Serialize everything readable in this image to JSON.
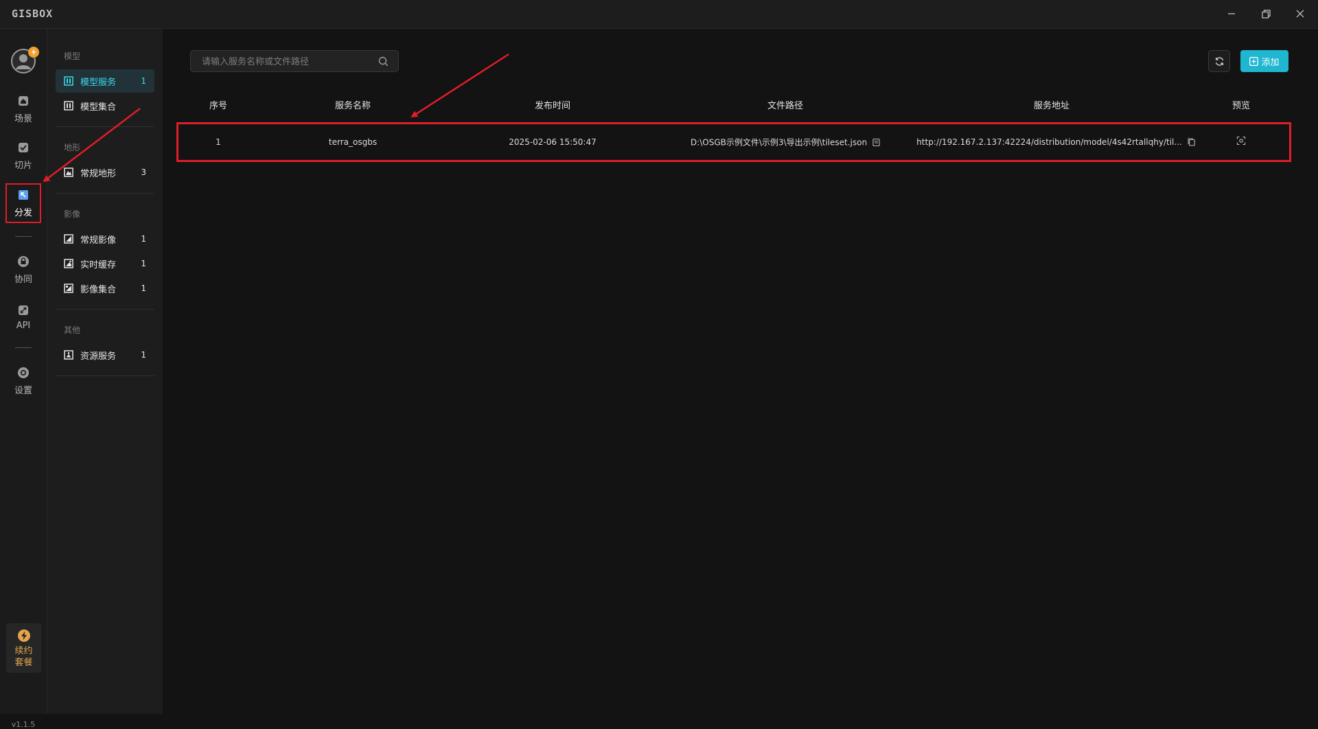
{
  "app": {
    "logo": "GISBOX"
  },
  "rail": {
    "items": [
      {
        "label": "场景"
      },
      {
        "label": "切片"
      },
      {
        "label": "分发"
      },
      {
        "label": "协同"
      },
      {
        "label": "API"
      },
      {
        "label": "设置"
      }
    ],
    "renew_label": "续约套餐",
    "version": "v1.1.5"
  },
  "panel": {
    "groups": [
      {
        "title": "模型",
        "items": [
          {
            "label": "模型服务",
            "count": "1"
          },
          {
            "label": "模型集合",
            "count": ""
          }
        ]
      },
      {
        "title": "地形",
        "items": [
          {
            "label": "常规地形",
            "count": "3"
          }
        ]
      },
      {
        "title": "影像",
        "items": [
          {
            "label": "常规影像",
            "count": "1"
          },
          {
            "label": "实时缓存",
            "count": "1"
          },
          {
            "label": "影像集合",
            "count": "1"
          }
        ]
      },
      {
        "title": "其他",
        "items": [
          {
            "label": "资源服务",
            "count": "1"
          }
        ]
      }
    ]
  },
  "main": {
    "search": {
      "placeholder": "请输入服务名称或文件路径",
      "value": ""
    },
    "add_label": "添加",
    "table": {
      "headers": [
        "序号",
        "服务名称",
        "发布时间",
        "文件路径",
        "服务地址",
        "预览"
      ],
      "rows": [
        {
          "index": "1",
          "name": "terra_osgbs",
          "time": "2025-02-06 15:50:47",
          "path": "D:\\OSGB示例文件\\示例3\\导出示例\\tileset.json",
          "url": "http://192.167.2.137:42224/distribution/model/4s42rtallqhy/til..."
        }
      ]
    }
  },
  "colors": {
    "accent": "#1fb6d0",
    "highlight": "#e21d2a",
    "active_text": "#3fd7ea"
  }
}
